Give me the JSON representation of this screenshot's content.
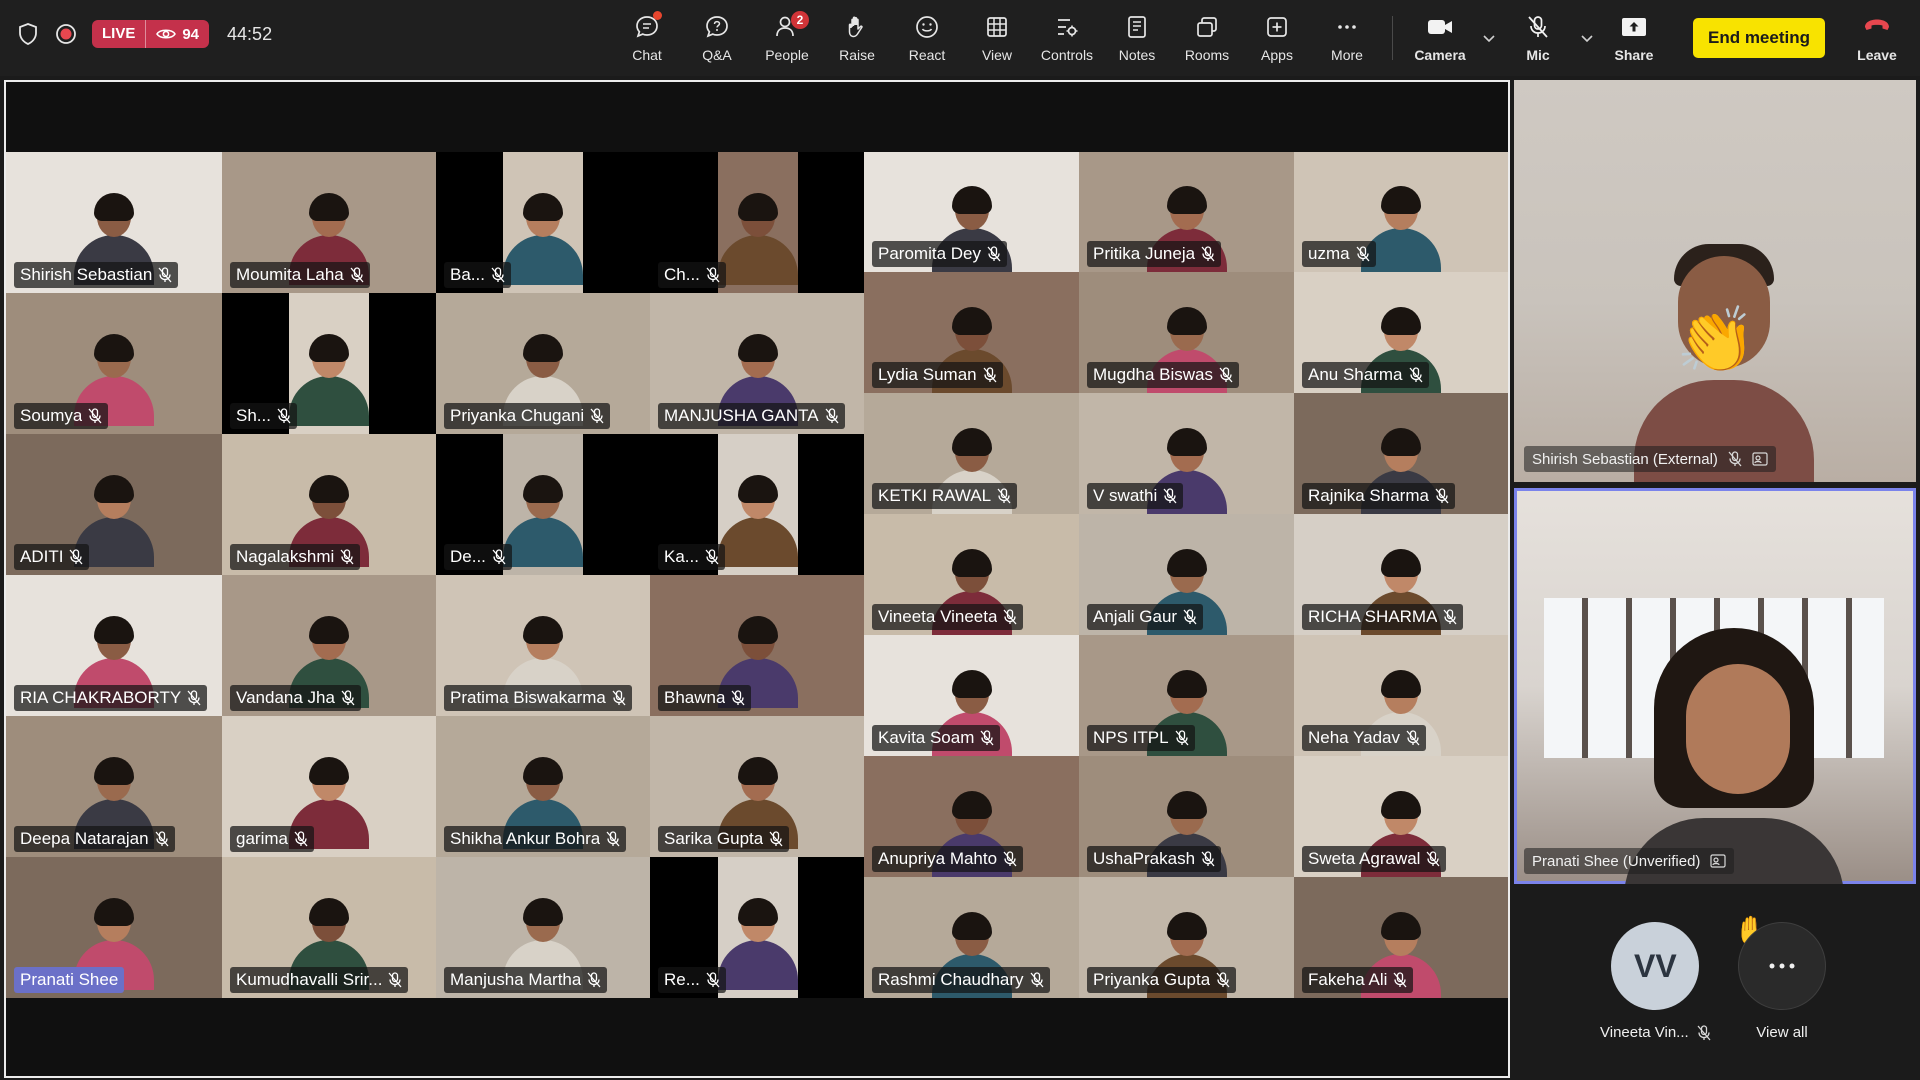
{
  "status": {
    "live_label": "LIVE",
    "viewer_count": "94",
    "elapsed": "44:52"
  },
  "toolbar": {
    "chat": "Chat",
    "qa": "Q&A",
    "people": "People",
    "people_badge": "2",
    "raise": "Raise",
    "react": "React",
    "view": "View",
    "controls": "Controls",
    "notes": "Notes",
    "rooms": "Rooms",
    "apps": "Apps",
    "more": "More",
    "camera": "Camera",
    "mic": "Mic",
    "share": "Share",
    "end_meeting": "End meeting",
    "leave": "Leave"
  },
  "colors": {
    "accent": "#7b83eb",
    "live": "#c4314b",
    "end_button": "#f8e300",
    "leave_icon": "#e8474f"
  },
  "participants": [
    "Shirish Sebastian",
    "Moumita Laha",
    "Ba...",
    "Ch...",
    "Soumya",
    "Sh...",
    "Priyanka Chugani",
    "MANJUSHA GANTA",
    "ADITI",
    "Nagalakshmi",
    "De...",
    "Ka...",
    "RIA CHAKRABORTY",
    "Vandana Jha",
    "Pratima Biswakarma",
    "Bhawna",
    "Deepa Natarajan",
    "garima",
    "Shikha Ankur Bohra",
    "Sarika Gupta",
    "Pranati Shee",
    "Kumudhavalli Srir...",
    "Manjusha Martha",
    "Re...",
    "Paromita Dey",
    "Pritika Juneja",
    "uzma",
    "Lydia Suman",
    "Mugdha Biswas",
    "Anu Sharma",
    "KETKI RAWAL",
    "V swathi",
    "Rajnika Sharma",
    "Vineeta Vineeta",
    "Anjali Gaur",
    "RICHA SHARMA",
    "Kavita Soam",
    "NPS ITPL",
    "Neha Yadav",
    "Anupriya Mahto",
    "UshaPrakash",
    "Sweta Agrawal",
    "Rashmi Chaudhary",
    "Priyanka Gupta",
    "Fakeha Ali"
  ],
  "side": {
    "top_name": "Shirish Sebastian (External)",
    "main_name": "Pranati Shee (Unverified)",
    "chip_initials": "VV",
    "chip_name": "Vineeta Vin...",
    "view_all": "View all"
  }
}
